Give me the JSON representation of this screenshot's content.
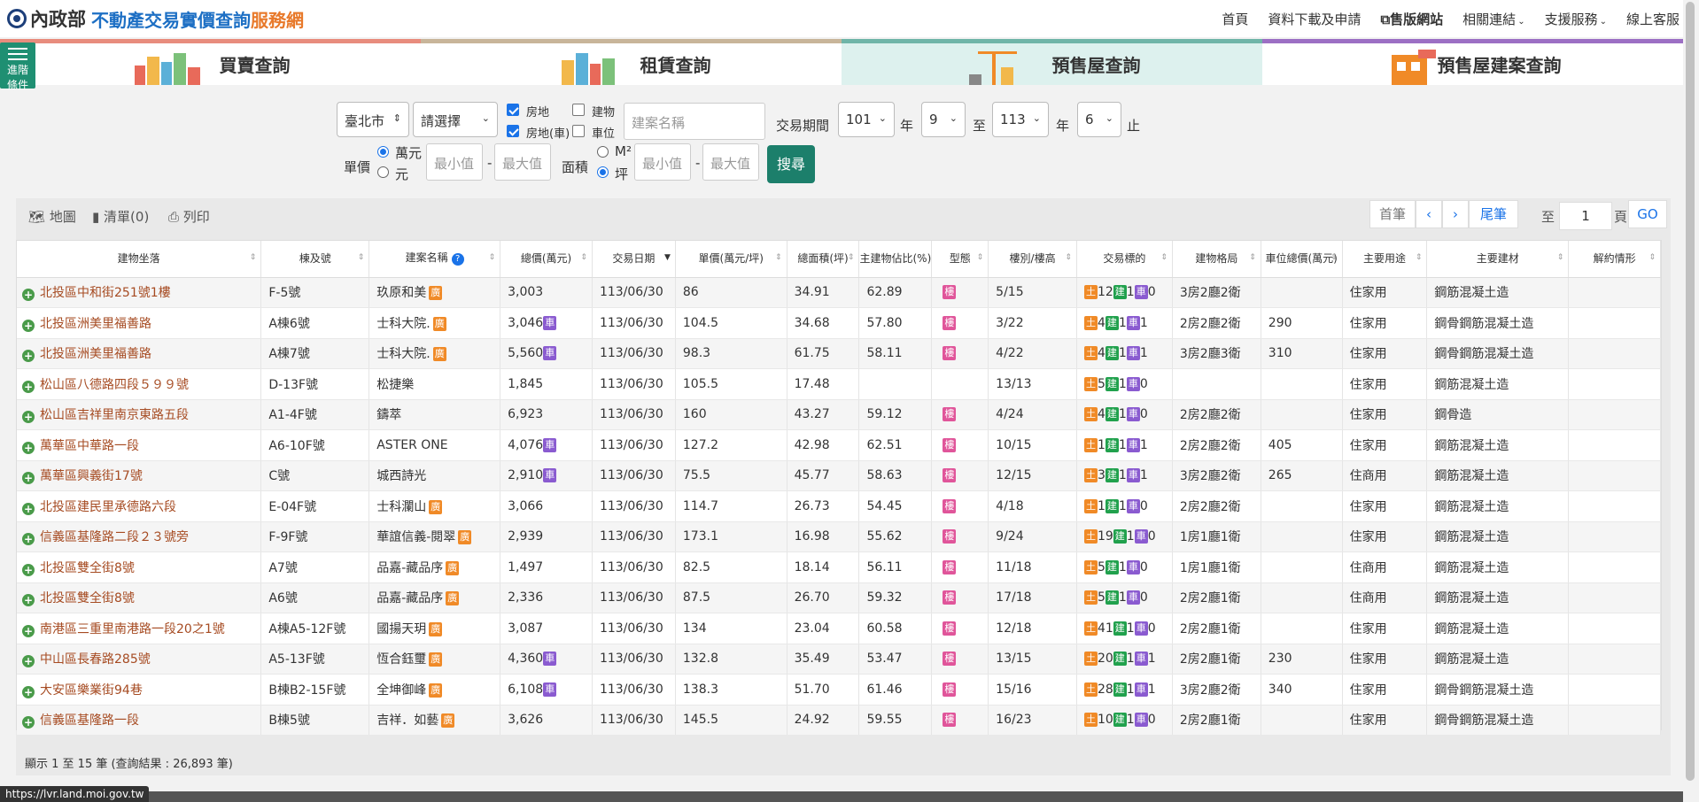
{
  "header": {
    "logo_part1": "內政部",
    "logo_part2": "不動產交易實價查詢",
    "logo_part3": "服務網",
    "nav": [
      "首頁",
      "資料下載及申請",
      "售版網站",
      "相關連結",
      "支援服務",
      "線上客服"
    ]
  },
  "tabs": [
    {
      "label": "買賣查詢",
      "color": "#e88c7d"
    },
    {
      "label": "租賃查詢",
      "color": "#c8b59a"
    },
    {
      "label": "預售屋查詢",
      "color": "#6fb5a8"
    },
    {
      "label": "預售屋建案查詢",
      "color": "#9c6fc4"
    }
  ],
  "advanced": {
    "label_line1": "進階",
    "label_line2": "條件"
  },
  "filters": {
    "city": "臺北市",
    "district": "請選擇",
    "check_land": "房地",
    "check_land_car": "房地(車)",
    "check_building": "建物",
    "check_parking": "車位",
    "project_placeholder": "建案名稱",
    "period_label": "交易期間",
    "year_from": "101",
    "month_from": "9",
    "year_to": "113",
    "month_to": "6",
    "year_word": "年",
    "to_word": "至",
    "end_word": "止",
    "unit_price_label": "單價",
    "unit_wan": "萬元",
    "unit_yuan": "元",
    "min_placeholder": "最小值",
    "max_placeholder": "最大值",
    "area_label": "面積",
    "area_m2": "M²",
    "area_ping": "坪",
    "search_button": "搜尋"
  },
  "toolbar": {
    "map": "地圖",
    "list": "清單(0)",
    "print": "列印",
    "first": "首筆",
    "prev": "‹",
    "next": "›",
    "last": "尾筆",
    "to": "至",
    "page_value": "1",
    "page_unit": "頁",
    "go": "GO"
  },
  "table": {
    "columns": [
      "建物坐落",
      "棟及號",
      "建案名稱",
      "總價(萬元)",
      "交易日期",
      "單價(萬元/坪)",
      "總面積(坪)",
      "主建物佔比(%)",
      "型態",
      "樓別/樓高",
      "交易標的",
      "建物格局",
      "車位總價(萬元)",
      "主要用途",
      "主要建材",
      "解約情形"
    ],
    "rows": [
      {
        "addr": "北投區中和街251號1樓",
        "unit": "F-5號",
        "project": "玖原和美",
        "project_badge": "廣",
        "total": "3,003",
        "car": false,
        "date": "113/06/30",
        "price": "86",
        "area": "34.91",
        "ratio": "62.89",
        "type": "樓",
        "floor": "5/15",
        "land": "12",
        "bld": "1",
        "park": "0",
        "layout": "3房2廳2衛",
        "car_price": "",
        "use": "住家用",
        "material": "鋼筋混凝土造",
        "cancel": ""
      },
      {
        "addr": "北投區洲美里福善路",
        "unit": "A棟6號",
        "project": "士科大院.",
        "project_badge": "廣",
        "total": "3,046",
        "car": true,
        "date": "113/06/30",
        "price": "104.5",
        "area": "34.68",
        "ratio": "57.80",
        "type": "樓",
        "floor": "3/22",
        "land": "4",
        "bld": "1",
        "park": "1",
        "layout": "2房2廳2衛",
        "car_price": "290",
        "use": "住家用",
        "material": "鋼骨鋼筋混凝土造",
        "cancel": ""
      },
      {
        "addr": "北投區洲美里福善路",
        "unit": "A棟7號",
        "project": "士科大院.",
        "project_badge": "廣",
        "total": "5,560",
        "car": true,
        "date": "113/06/30",
        "price": "98.3",
        "area": "61.75",
        "ratio": "58.11",
        "type": "樓",
        "floor": "4/22",
        "land": "4",
        "bld": "1",
        "park": "1",
        "layout": "3房2廳3衛",
        "car_price": "310",
        "use": "住家用",
        "material": "鋼骨鋼筋混凝土造",
        "cancel": ""
      },
      {
        "addr": "松山區八德路四段５９９號",
        "unit": "D-13F號",
        "project": "松捷樂",
        "project_badge": "",
        "total": "1,845",
        "car": false,
        "date": "113/06/30",
        "price": "105.5",
        "area": "17.48",
        "ratio": "",
        "type": "",
        "floor": "13/13",
        "land": "5",
        "bld": "1",
        "park": "0",
        "layout": "",
        "car_price": "",
        "use": "住家用",
        "material": "鋼筋混凝土造",
        "cancel": ""
      },
      {
        "addr": "松山區吉祥里南京東路五段",
        "unit": "A1-4F號",
        "project": "鑄萃",
        "project_badge": "",
        "total": "6,923",
        "car": false,
        "date": "113/06/30",
        "price": "160",
        "area": "43.27",
        "ratio": "59.12",
        "type": "樓",
        "floor": "4/24",
        "land": "4",
        "bld": "1",
        "park": "0",
        "layout": "2房2廳2衛",
        "car_price": "",
        "use": "住家用",
        "material": "鋼骨造",
        "cancel": ""
      },
      {
        "addr": "萬華區中華路一段",
        "unit": "A6-10F號",
        "project": "ASTER ONE",
        "project_badge": "",
        "total": "4,076",
        "car": true,
        "date": "113/06/30",
        "price": "127.2",
        "area": "42.98",
        "ratio": "62.51",
        "type": "樓",
        "floor": "10/15",
        "land": "1",
        "bld": "1",
        "park": "1",
        "layout": "2房2廳2衛",
        "car_price": "405",
        "use": "住家用",
        "material": "鋼筋混凝土造",
        "cancel": ""
      },
      {
        "addr": "萬華區興義街17號",
        "unit": "C號",
        "project": "城西詩光",
        "project_badge": "",
        "total": "2,910",
        "car": true,
        "date": "113/06/30",
        "price": "75.5",
        "area": "45.77",
        "ratio": "58.63",
        "type": "樓",
        "floor": "12/15",
        "land": "3",
        "bld": "1",
        "park": "1",
        "layout": "3房2廳2衛",
        "car_price": "265",
        "use": "住商用",
        "material": "鋼筋混凝土造",
        "cancel": ""
      },
      {
        "addr": "北投區建民里承德路六段",
        "unit": "E-04F號",
        "project": "士科瀾山",
        "project_badge": "廣",
        "total": "3,066",
        "car": false,
        "date": "113/06/30",
        "price": "114.7",
        "area": "26.73",
        "ratio": "54.45",
        "type": "樓",
        "floor": "4/18",
        "land": "1",
        "bld": "1",
        "park": "0",
        "layout": "2房2廳2衛",
        "car_price": "",
        "use": "住家用",
        "material": "鋼筋混凝土造",
        "cancel": ""
      },
      {
        "addr": "信義區基隆路二段２３號旁",
        "unit": "F-9F號",
        "project": "華誼信義-閱翠",
        "project_badge": "廣",
        "total": "2,939",
        "car": false,
        "date": "113/06/30",
        "price": "173.1",
        "area": "16.98",
        "ratio": "55.62",
        "type": "樓",
        "floor": "9/24",
        "land": "19",
        "bld": "1",
        "park": "0",
        "layout": "1房1廳1衛",
        "car_price": "",
        "use": "住家用",
        "material": "鋼筋混凝土造",
        "cancel": ""
      },
      {
        "addr": "北投區雙全街8號",
        "unit": "A7號",
        "project": "品嘉-藏品序",
        "project_badge": "廣",
        "total": "1,497",
        "car": false,
        "date": "113/06/30",
        "price": "82.5",
        "area": "18.14",
        "ratio": "56.11",
        "type": "樓",
        "floor": "11/18",
        "land": "5",
        "bld": "1",
        "park": "0",
        "layout": "1房1廳1衛",
        "car_price": "",
        "use": "住商用",
        "material": "鋼筋混凝土造",
        "cancel": ""
      },
      {
        "addr": "北投區雙全街8號",
        "unit": "A6號",
        "project": "品嘉-藏品序",
        "project_badge": "廣",
        "total": "2,336",
        "car": false,
        "date": "113/06/30",
        "price": "87.5",
        "area": "26.70",
        "ratio": "59.32",
        "type": "樓",
        "floor": "17/18",
        "land": "5",
        "bld": "1",
        "park": "0",
        "layout": "2房2廳1衛",
        "car_price": "",
        "use": "住商用",
        "material": "鋼筋混凝土造",
        "cancel": ""
      },
      {
        "addr": "南港區三重里南港路一段20之1號",
        "unit": "A棟A5-12F號",
        "project": "國揚天玥",
        "project_badge": "廣",
        "total": "3,087",
        "car": false,
        "date": "113/06/30",
        "price": "134",
        "area": "23.04",
        "ratio": "60.58",
        "type": "樓",
        "floor": "12/18",
        "land": "41",
        "bld": "1",
        "park": "0",
        "layout": "2房2廳1衛",
        "car_price": "",
        "use": "住家用",
        "material": "鋼筋混凝土造",
        "cancel": ""
      },
      {
        "addr": "中山區長春路285號",
        "unit": "A5-13F號",
        "project": "恆合鈺璽",
        "project_badge": "廣",
        "total": "4,360",
        "car": true,
        "date": "113/06/30",
        "price": "132.8",
        "area": "35.49",
        "ratio": "53.47",
        "type": "樓",
        "floor": "13/15",
        "land": "20",
        "bld": "1",
        "park": "1",
        "layout": "2房2廳1衛",
        "car_price": "230",
        "use": "住家用",
        "material": "鋼筋混凝土造",
        "cancel": ""
      },
      {
        "addr": "大安區樂業街94巷",
        "unit": "B棟B2-15F號",
        "project": "全坤御峰",
        "project_badge": "廣",
        "total": "6,108",
        "car": true,
        "date": "113/06/30",
        "price": "138.3",
        "area": "51.70",
        "ratio": "61.46",
        "type": "樓",
        "floor": "15/16",
        "land": "28",
        "bld": "1",
        "park": "1",
        "layout": "3房2廳2衛",
        "car_price": "340",
        "use": "住家用",
        "material": "鋼骨鋼筋混凝土造",
        "cancel": ""
      },
      {
        "addr": "信義區基隆路一段",
        "unit": "B棟5號",
        "project": "吉祥．如藝",
        "project_badge": "廣",
        "total": "3,626",
        "car": false,
        "date": "113/06/30",
        "price": "145.5",
        "area": "24.92",
        "ratio": "59.55",
        "type": "樓",
        "floor": "16/23",
        "land": "10",
        "bld": "1",
        "park": "0",
        "layout": "2房2廳1衛",
        "car_price": "",
        "use": "住家用",
        "material": "鋼骨鋼筋混凝土造",
        "cancel": ""
      }
    ],
    "badge_land": "土",
    "badge_bld": "建",
    "badge_car": "車"
  },
  "footer": {
    "summary": "顯示 1 至 15 筆 (查詢結果 : 26,893 筆)"
  },
  "status_url": "https://lvr.land.moi.gov.tw"
}
